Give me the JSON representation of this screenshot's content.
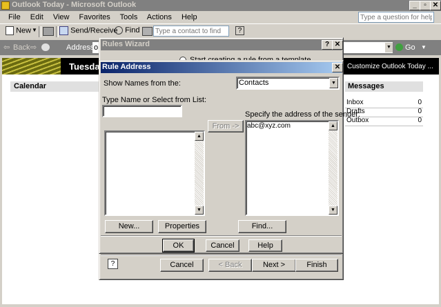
{
  "outlook": {
    "title": "Outlook Today - Microsoft Outlook",
    "menu": [
      "File",
      "Edit",
      "View",
      "Favorites",
      "Tools",
      "Actions",
      "Help"
    ],
    "help_placeholder": "Type a question for help",
    "toolbar": {
      "new": "New",
      "send_receive": "Send/Receive",
      "find": "Find",
      "contact_placeholder": "Type a contact to find"
    },
    "nav": {
      "back": "Back",
      "address_label": "Address",
      "address_value": "o",
      "go": "Go"
    },
    "banner": {
      "date": "Tuesday",
      "customize": "Customize Outlook Today ..."
    },
    "calendar_header": "Calendar",
    "messages_header": "Messages",
    "messages": [
      {
        "name": "Inbox",
        "count": "0"
      },
      {
        "name": "Drafts",
        "count": "0"
      },
      {
        "name": "Outbox",
        "count": "0"
      }
    ]
  },
  "rules_wizard": {
    "title": "Rules Wizard",
    "option_partial": "Start creating a rule from a template",
    "buttons": {
      "cancel": "Cancel",
      "back": "< Back",
      "next": "Next >",
      "finish": "Finish"
    }
  },
  "rule_address": {
    "title": "Rule Address",
    "show_names_label": "Show Names from the:",
    "show_names_value": "Contacts",
    "type_name_label": "Type Name or Select from List:",
    "type_name_value": "",
    "from_button": "From ->",
    "specify_label": "Specify the address of the sender:",
    "sender_addresses": [
      "abc@xyz.com"
    ],
    "buttons": {
      "new": "New...",
      "properties": "Properties",
      "find": "Find...",
      "ok": "OK",
      "cancel": "Cancel",
      "help": "Help"
    }
  },
  "colors": {
    "active_title": "#0a246a",
    "inactive_title": "#808080",
    "face": "#d4d0c8",
    "banner_bg": "#000000"
  }
}
